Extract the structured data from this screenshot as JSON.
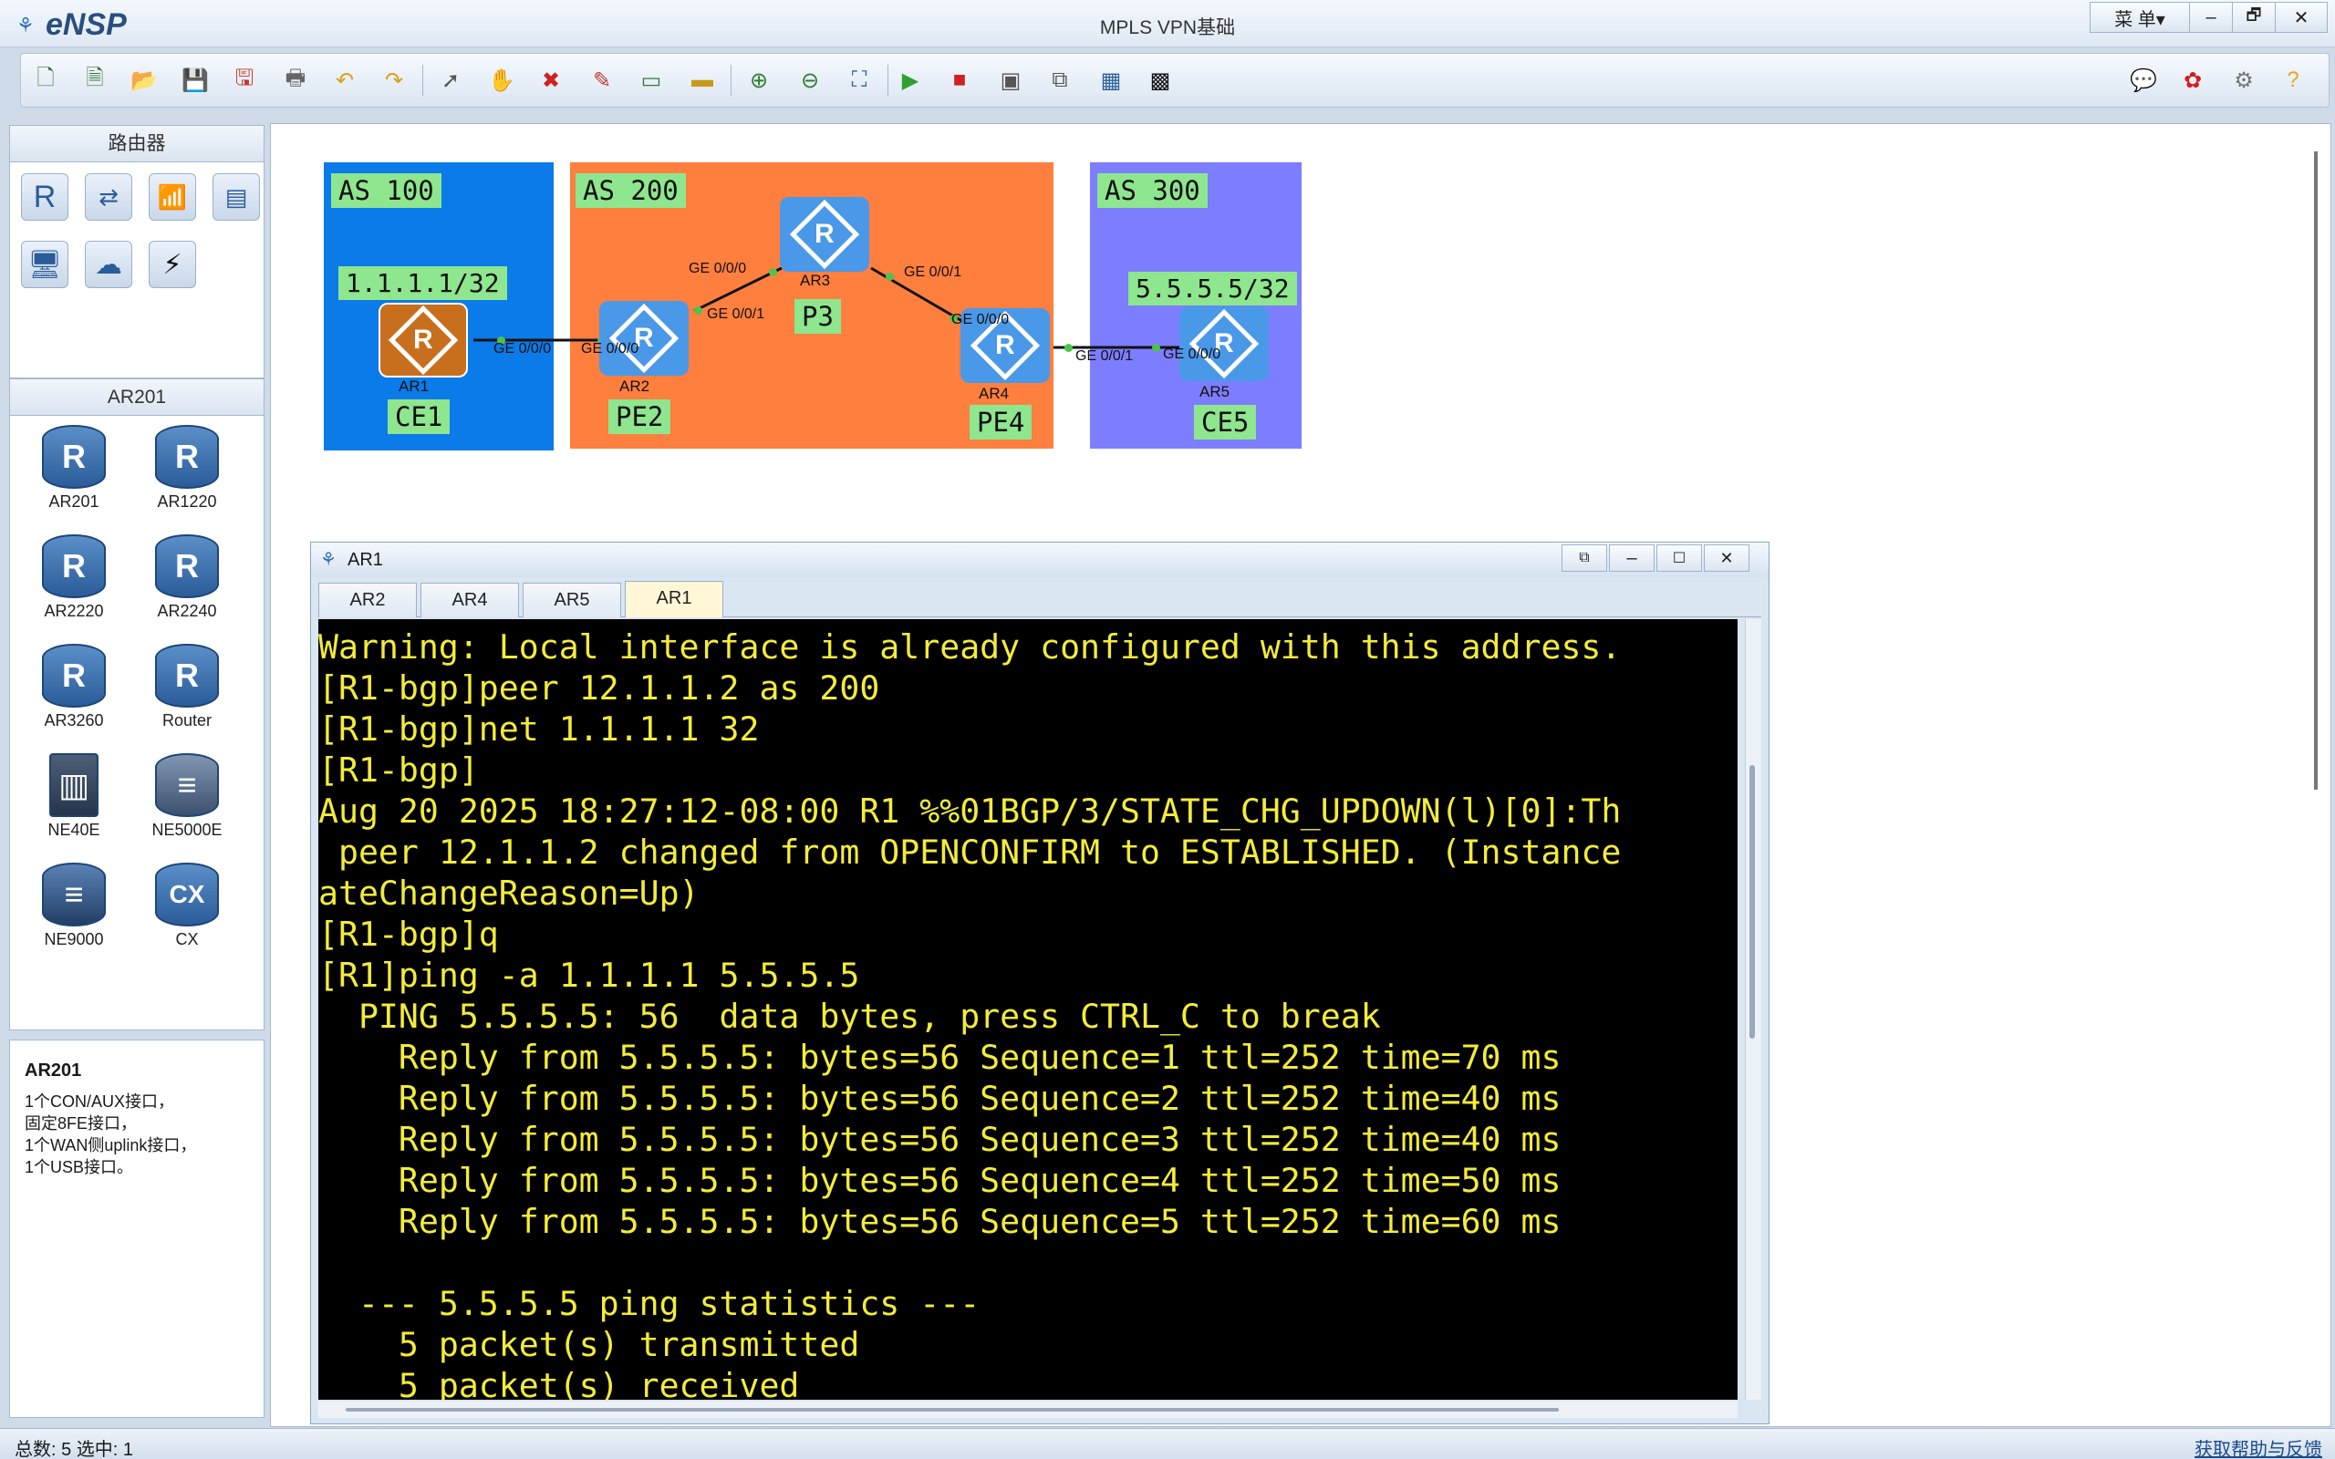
{
  "app": {
    "name": "eNSP",
    "title": "MPLS VPN基础",
    "menu_label": "菜 单▾",
    "minimize": "–",
    "restore": "🗗",
    "close": "✕"
  },
  "toolbar": {
    "icons": [
      "new-topology-icon",
      "new-example-icon",
      "open-icon",
      "save-icon",
      "save-as-icon",
      "print-icon",
      "undo-icon",
      "redo-icon",
      "select-icon",
      "pan-icon",
      "delete-icon",
      "delete-link-icon",
      "text-icon",
      "palette-icon",
      "zoom-in-icon",
      "zoom-out-icon",
      "fit-icon",
      "start-icon",
      "stop-icon",
      "capture-icon",
      "topology-icon",
      "grid-icon",
      "cli-icon"
    ],
    "right_icons": [
      "feedback-icon",
      "huawei-icon",
      "settings-icon",
      "help-icon"
    ]
  },
  "palette_top": {
    "title": "路由器",
    "icons": [
      "router-category-icon",
      "switch-category-icon",
      "wireless-category-icon",
      "firewall-category-icon",
      "pc-category-icon",
      "cloud-category-icon",
      "connection-category-icon"
    ]
  },
  "palette_devices": {
    "title": "AR201",
    "items": [
      {
        "label": "AR201",
        "glyph": "R"
      },
      {
        "label": "AR1220",
        "glyph": "R"
      },
      {
        "label": "AR2220",
        "glyph": "R"
      },
      {
        "label": "AR2240",
        "glyph": "R"
      },
      {
        "label": "AR3260",
        "glyph": "R"
      },
      {
        "label": "Router",
        "glyph": "R"
      },
      {
        "label": "NE40E",
        "glyph": "▥"
      },
      {
        "label": "NE5000E",
        "glyph": "≡"
      },
      {
        "label": "NE9000",
        "glyph": "≡"
      },
      {
        "label": "CX",
        "glyph": "CX"
      }
    ]
  },
  "device_info": {
    "name": "AR201",
    "lines": [
      "1个CON/AUX接口，",
      "固定8FE接口，",
      "1个WAN侧uplink接口，",
      "1个USB接口。"
    ]
  },
  "topology": {
    "areas": [
      {
        "label": "AS 100",
        "color": "#0a7be8"
      },
      {
        "label": "AS 200",
        "color": "#ff7f3f"
      },
      {
        "label": "AS 300",
        "color": "#7d7dff"
      }
    ],
    "labels": {
      "ce1_ip": "1.1.1.1/32",
      "ce5_ip": "5.5.5.5/32",
      "ce1": "CE1",
      "pe2": "PE2",
      "p3": "P3",
      "pe4": "PE4",
      "ce5": "CE5"
    },
    "routers": [
      {
        "name": "AR1",
        "glyph": "R",
        "color": "#c86f1e"
      },
      {
        "name": "AR2",
        "glyph": "R",
        "color": "#4a98e8"
      },
      {
        "name": "AR3",
        "glyph": "R",
        "color": "#4a98e8"
      },
      {
        "name": "AR4",
        "glyph": "R",
        "color": "#4a98e8"
      },
      {
        "name": "AR5",
        "glyph": "R",
        "color": "#4a98e8"
      }
    ],
    "ports": {
      "ar1_ge000": "GE 0/0/0",
      "ar2_ge000": "GE 0/0/0",
      "ar2_ge001": "GE 0/0/1",
      "ar3_ge000": "GE 0/0/0",
      "ar3_ge001": "GE 0/0/1",
      "ar4_ge000": "GE 0/0/0",
      "ar4_ge001": "GE 0/0/1",
      "ar5_ge000": "GE 0/0/0"
    }
  },
  "console": {
    "title": "AR1",
    "tabs": [
      "AR2",
      "AR4",
      "AR5",
      "AR1"
    ],
    "active_tab": "AR1",
    "lines": [
      "Warning: Local interface is already configured with this address.",
      "[R1-bgp]peer 12.1.1.2 as 200",
      "[R1-bgp]net 1.1.1.1 32",
      "[R1-bgp]",
      "Aug 20 2025 18:27:12-08:00 R1 %%01BGP/3/STATE_CHG_UPDOWN(l)[0]:Th",
      " peer 12.1.1.2 changed from OPENCONFIRM to ESTABLISHED. (Instance",
      "ateChangeReason=Up)",
      "[R1-bgp]q",
      "[R1]ping -a 1.1.1.1 5.5.5.5",
      "  PING 5.5.5.5: 56  data bytes, press CTRL_C to break",
      "    Reply from 5.5.5.5: bytes=56 Sequence=1 ttl=252 time=70 ms",
      "    Reply from 5.5.5.5: bytes=56 Sequence=2 ttl=252 time=40 ms",
      "    Reply from 5.5.5.5: bytes=56 Sequence=3 ttl=252 time=40 ms",
      "    Reply from 5.5.5.5: bytes=56 Sequence=4 ttl=252 time=50 ms",
      "    Reply from 5.5.5.5: bytes=56 Sequence=5 ttl=252 time=60 ms",
      "",
      "  --- 5.5.5.5 ping statistics ---",
      "    5 packet(s) transmitted",
      "    5 packet(s) received"
    ]
  },
  "status": {
    "left": "总数: 5 选中: 1",
    "right": "获取帮助与反馈"
  }
}
